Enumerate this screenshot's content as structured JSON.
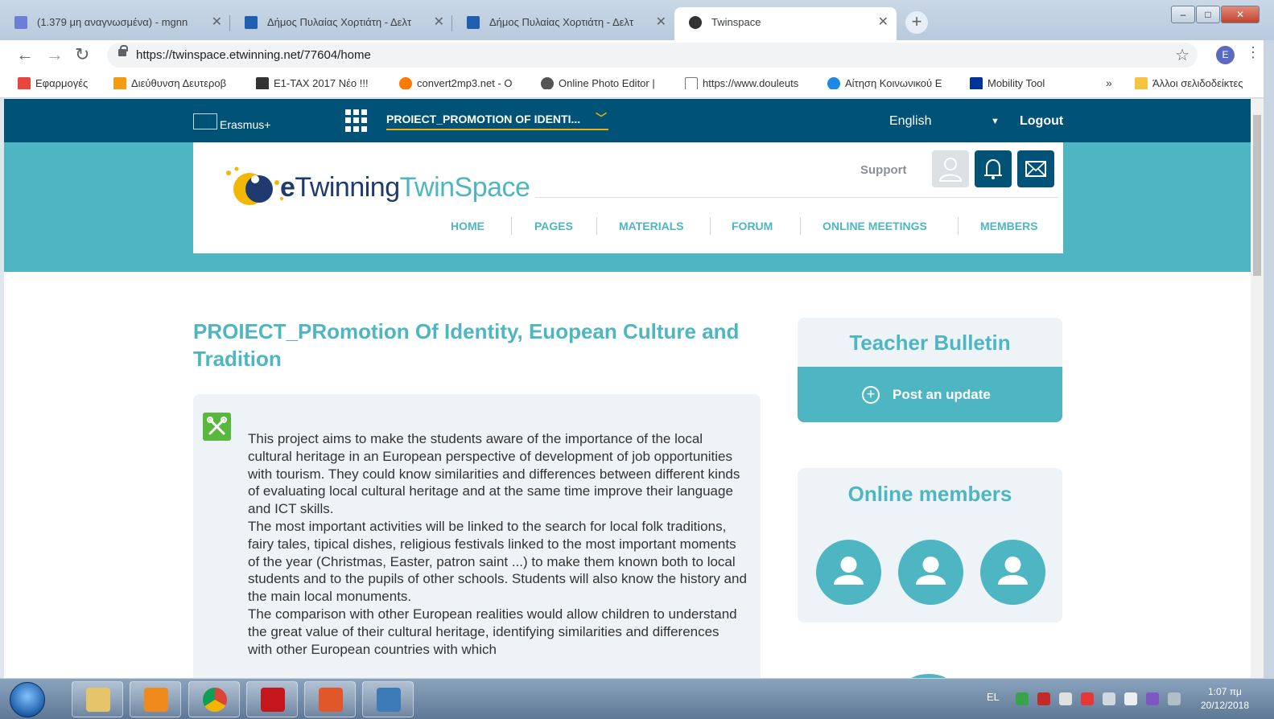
{
  "browser": {
    "tabs": [
      {
        "title": "(1.379 μη αναγνωσμένα) - mgnn",
        "icon": "mail-icon",
        "color": "#6b7fd7"
      },
      {
        "title": "Δήμος Πυλαίας Χορτιάτη - Δελτ",
        "icon": "page-icon",
        "color": "#1f5fae"
      },
      {
        "title": "Δήμος Πυλαίας Χορτιάτη - Δελτ",
        "icon": "page-icon",
        "color": "#1f5fae"
      },
      {
        "title": "Twinspace",
        "icon": "twinspace-icon",
        "color": "#333333"
      }
    ],
    "new_tab_label": "+",
    "url": "https://twinspace.etwinning.net/77604/home",
    "profile_initial": "E",
    "bookmarks": [
      {
        "label": "Εφαρμογές",
        "color": "#e8453c"
      },
      {
        "label": "Διεύθυνση Δευτεροβ",
        "color": "#f39c12"
      },
      {
        "label": "E1-TAX 2017 Νέο !!!",
        "color": "#333333"
      },
      {
        "label": "convert2mp3.net - O",
        "color": "#ff7a00"
      },
      {
        "label": "Online Photo Editor |",
        "color": "#555555"
      },
      {
        "label": "https://www.douleuts",
        "color": "#777777"
      },
      {
        "label": "Αίτηση Κοινωνικού Ε",
        "color": "#1e88e5"
      },
      {
        "label": "Mobility Tool",
        "color": "#003399"
      }
    ],
    "bookmarks_more": "»",
    "other_bookmarks": "Άλλοι σελιδοδείκτες"
  },
  "site": {
    "erasmus_label": "Erasmus+",
    "project_selector": "PROIECT_PROMOTION OF IDENTI...",
    "language": "English",
    "logout": "Logout",
    "logo": {
      "e": "e",
      "twinning": "Twinning",
      "twinspace": "TwinSpace"
    },
    "support": "Support",
    "nav": [
      "HOME",
      "PAGES",
      "MATERIALS",
      "FORUM",
      "ONLINE MEETINGS",
      "MEMBERS"
    ],
    "project_title": "PROIECT_PRomotion Of Identity, Euopean Culture and Tradition",
    "description": [
      "This project aims to make the students aware of the importance of the local cultural heritage in an European perspective of development of job opportunities with tourism. They could know similarities and differences between different kinds of evaluating local cultural heritage and at the same time improve their language and ICT skills.",
      "The most important activities will be linked to the search for local folk traditions, fairy tales, tipical dishes, religious festivals linked to the most important moments of the year (Christmas, Easter, patron saint ...) to make them known both to local students and to the pupils of other schools. Students will also know the history and the main local monuments.",
      "The comparison with other European realities would allow children to understand the great value of their cultural heritage, identifying similarities and differences with other European countries with which"
    ],
    "teacher_bulletin": {
      "title": "Teacher Bulletin",
      "post_label": "Post an update"
    },
    "online_members": {
      "title": "Online members",
      "count": 3
    },
    "accent": "#4eb6c2",
    "dark": "#005377"
  },
  "taskbar": {
    "language": "EL",
    "time": "1:07 πμ",
    "date": "20/12/2018"
  }
}
